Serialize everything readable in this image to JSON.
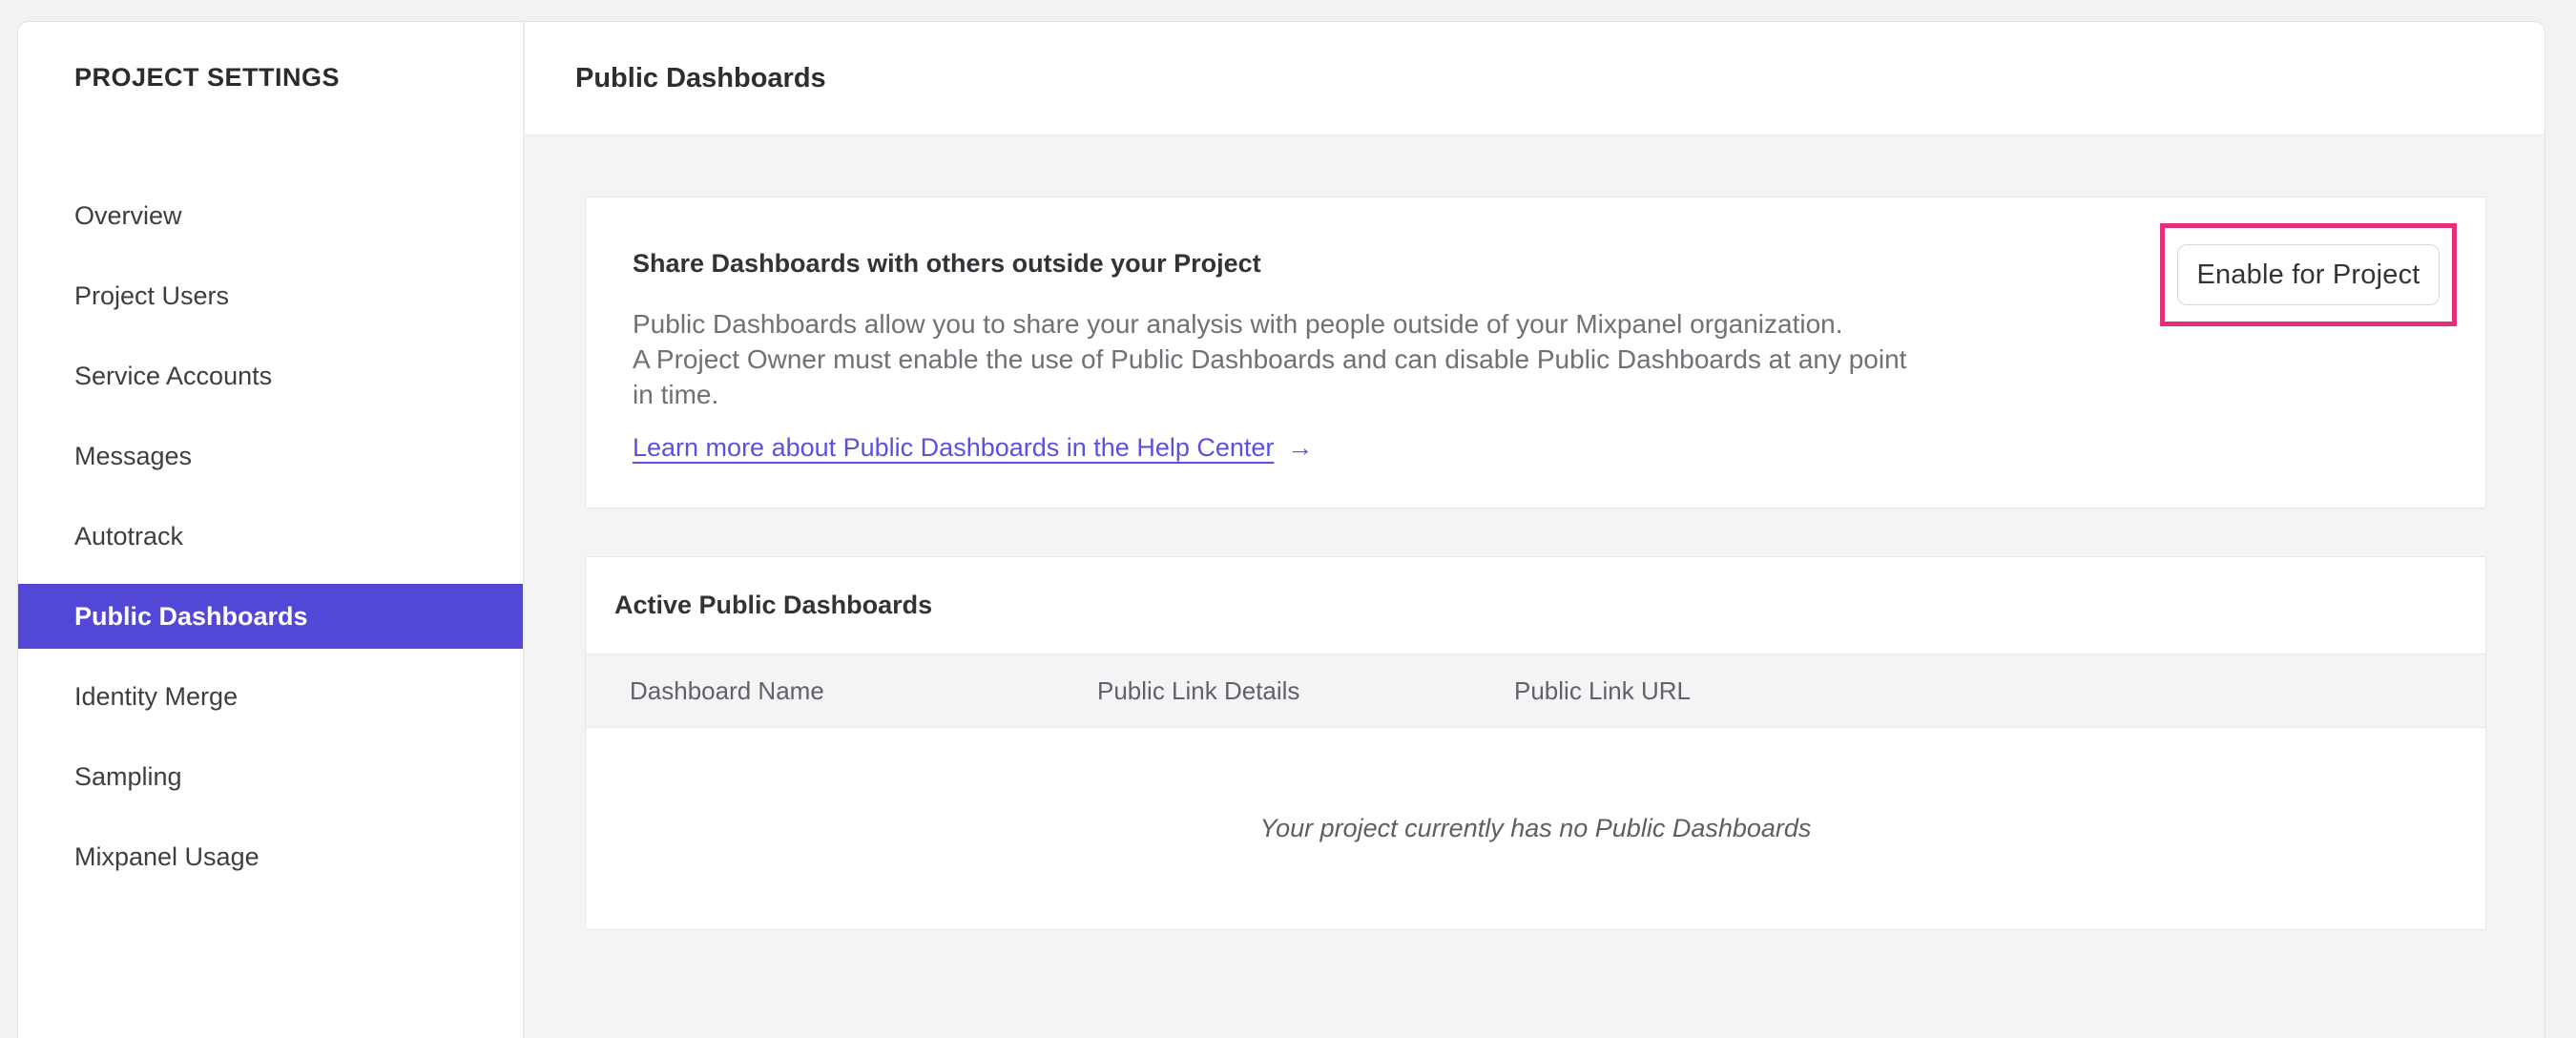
{
  "colors": {
    "accent_purple": "#5247D6",
    "link_purple": "#5B50E0",
    "highlight_pink": "#E62F7B"
  },
  "sidebar": {
    "title": "PROJECT SETTINGS",
    "items": [
      {
        "label": "Overview",
        "selected": false
      },
      {
        "label": "Project Users",
        "selected": false
      },
      {
        "label": "Service Accounts",
        "selected": false
      },
      {
        "label": "Messages",
        "selected": false
      },
      {
        "label": "Autotrack",
        "selected": false
      },
      {
        "label": "Public Dashboards",
        "selected": true
      },
      {
        "label": "Identity Merge",
        "selected": false
      },
      {
        "label": "Sampling",
        "selected": false
      },
      {
        "label": "Mixpanel Usage",
        "selected": false
      }
    ]
  },
  "header": {
    "title": "Public Dashboards"
  },
  "share_card": {
    "heading": "Share Dashboards with others outside your Project",
    "description_lines": [
      "Public Dashboards allow you to share your analysis with people outside of your Mixpanel organization.",
      "A Project Owner must enable the use of Public Dashboards and can disable Public Dashboards at any point",
      "in time."
    ],
    "link_label": "Learn more about Public Dashboards in the Help Center",
    "link_arrow": "→",
    "button_label": "Enable for Project"
  },
  "active_card": {
    "heading": "Active Public Dashboards",
    "columns": [
      "Dashboard Name",
      "Public Link Details",
      "Public Link URL"
    ],
    "rows": [],
    "empty_message": "Your project currently has no Public Dashboards"
  }
}
